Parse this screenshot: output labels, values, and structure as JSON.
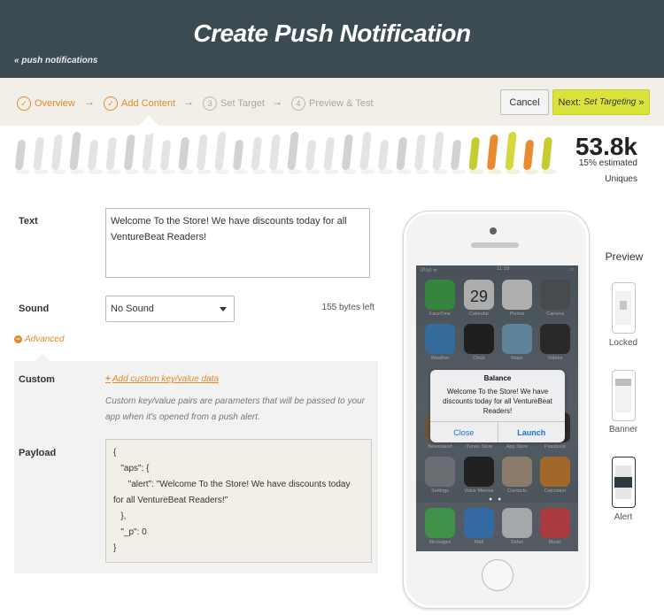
{
  "header": {
    "title": "Create Push Notification",
    "back_label": "« push notifications"
  },
  "steps": [
    {
      "num": "✓",
      "label": "Overview",
      "state": "done"
    },
    {
      "num": "✓",
      "label": "Add Content",
      "state": "done"
    },
    {
      "num": "3",
      "label": "Set Target",
      "state": "todo"
    },
    {
      "num": "4",
      "label": "Preview & Test",
      "state": "todo"
    }
  ],
  "actions": {
    "cancel_label": "Cancel",
    "next_label": "Next:",
    "next_sub": "Set Targeting",
    "next_arrow": "»"
  },
  "audience": {
    "count": "53.8k",
    "estimate": "15% estimated",
    "uniques": "Uniques",
    "highlight_fraction": 0.15
  },
  "form": {
    "text_label": "Text",
    "text_value": "Welcome To the Store! We have discounts today for all VentureBeat Readers!",
    "sound_label": "Sound",
    "sound_value": "No Sound",
    "bytes_left": "155 bytes left",
    "advanced_label": "Advanced",
    "custom_label": "Custom",
    "add_kv_label": "Add custom key/value data",
    "custom_hint": "Custom key/value pairs are parameters that will be passed to your app when it's opened from a push alert.",
    "payload_label": "Payload",
    "payload_lines": [
      "{",
      "   \"aps\": {",
      "      \"alert\": \"Welcome To the Store! We have discounts today",
      "for all VentureBeat Readers!\"",
      "   },",
      "   \"_p\": 0",
      "}"
    ]
  },
  "phone": {
    "status_left": "iPod ᯤ",
    "status_time": "11:16",
    "apps": [
      {
        "label": "FaceTime",
        "color": "#3fb54a"
      },
      {
        "label": "Calendar",
        "color": "#f4f4f4"
      },
      {
        "label": "Photos",
        "color": "#f7f7f7"
      },
      {
        "label": "Camera",
        "color": "#5a5e62"
      },
      {
        "label": "Weather",
        "color": "#3b8fd6"
      },
      {
        "label": "Clock",
        "color": "#1b1b1b"
      },
      {
        "label": "Maps",
        "color": "#78b4d8"
      },
      {
        "label": "Videos",
        "color": "#2a2a2a"
      },
      {
        "label": "Newsstand",
        "color": "#8c6d4a"
      },
      {
        "label": "iTunes Store",
        "color": "#b04bd9"
      },
      {
        "label": "App Store",
        "color": "#2f8fe0"
      },
      {
        "label": "Passbook",
        "color": "#2b2b2b"
      },
      {
        "label": "Settings",
        "color": "#8e9398"
      },
      {
        "label": "Voice Memos",
        "color": "#1e1e1e"
      },
      {
        "label": "Contacts",
        "color": "#bfa98a"
      },
      {
        "label": "Calculator",
        "color": "#e28a2a"
      }
    ],
    "calendar_day": "29",
    "dock": [
      {
        "label": "Messages",
        "color": "#4ecb5a"
      },
      {
        "label": "Mail",
        "color": "#3b8ee6"
      },
      {
        "label": "Safari",
        "color": "#e9eef2"
      },
      {
        "label": "Music",
        "color": "#f0434e"
      }
    ],
    "alert": {
      "title": "Balance",
      "message": "Welcome To the Store! We have discounts today for all VentureBeat Readers!",
      "close": "Close",
      "launch": "Launch"
    }
  },
  "preview": {
    "title": "Preview",
    "options": [
      {
        "label": "Locked",
        "selected": false
      },
      {
        "label": "Banner",
        "selected": false
      },
      {
        "label": "Alert",
        "selected": true
      }
    ]
  }
}
